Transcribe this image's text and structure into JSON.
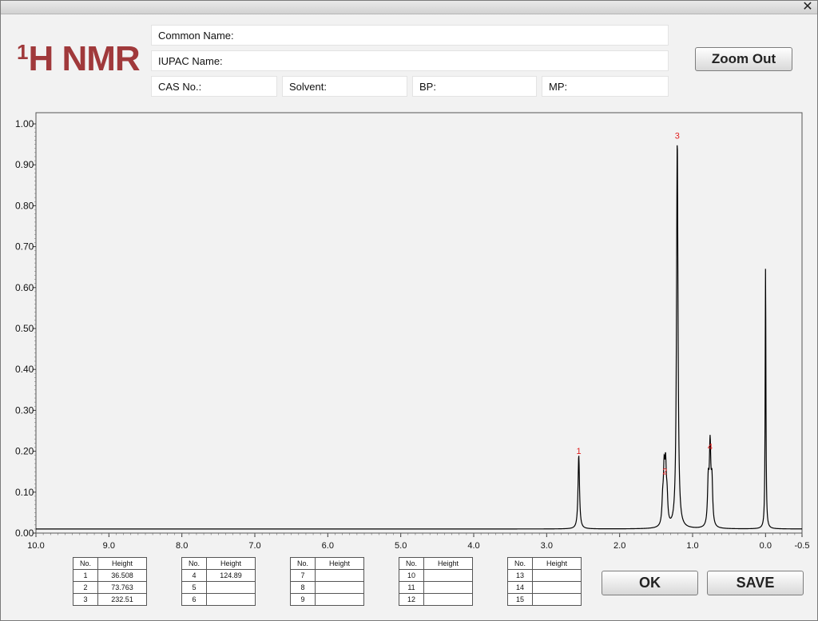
{
  "window": {
    "close_icon": "✕"
  },
  "title": {
    "superscript": "1",
    "text": "H NMR"
  },
  "fields": {
    "common_name": "Common Name:",
    "iupac_name": "IUPAC Name:",
    "cas_no": "CAS No.:",
    "solvent": "Solvent:",
    "bp": "BP:",
    "mp": "MP:"
  },
  "buttons": {
    "zoom_out": "Zoom Out",
    "ok": "OK",
    "save": "SAVE"
  },
  "colors": {
    "title": "#a0393b",
    "peak_label": "#e02020",
    "trace": "#000000"
  },
  "chart_data": {
    "type": "line",
    "x_ticks": [
      "10.0",
      "9.0",
      "8.0",
      "7.0",
      "6.0",
      "5.0",
      "4.0",
      "3.0",
      "2.0",
      "1.0",
      "0.0",
      "-0.5"
    ],
    "y_ticks": [
      "0.00",
      "0.10",
      "0.20",
      "0.30",
      "0.40",
      "0.50",
      "0.60",
      "0.70",
      "0.80",
      "0.90",
      "1.00"
    ],
    "xlim": [
      10.0,
      -0.5
    ],
    "ylim": [
      0,
      1.0
    ],
    "x_reversed": true,
    "grid": false,
    "baseline": 0.01,
    "peaks": [
      {
        "label": "1",
        "ppm": 2.56,
        "height": 0.18
      },
      {
        "label": "2",
        "ppm": 1.38,
        "height": 0.13
      },
      {
        "label": "3",
        "ppm": 1.21,
        "height": 0.95
      },
      {
        "label": "4",
        "ppm": 0.76,
        "height": 0.19
      },
      {
        "label": "",
        "ppm": 0.0,
        "height": 0.64
      }
    ]
  },
  "peak_tables": [
    {
      "headers": [
        "No.",
        "Height"
      ],
      "rows": [
        [
          "1",
          "36.508"
        ],
        [
          "2",
          "73.763"
        ],
        [
          "3",
          "232.51"
        ]
      ]
    },
    {
      "headers": [
        "No.",
        "Height"
      ],
      "rows": [
        [
          "4",
          "124.89"
        ],
        [
          "5",
          ""
        ],
        [
          "6",
          ""
        ]
      ]
    },
    {
      "headers": [
        "No.",
        "Height"
      ],
      "rows": [
        [
          "7",
          ""
        ],
        [
          "8",
          ""
        ],
        [
          "9",
          ""
        ]
      ]
    },
    {
      "headers": [
        "No.",
        "Height"
      ],
      "rows": [
        [
          "10",
          ""
        ],
        [
          "11",
          ""
        ],
        [
          "12",
          ""
        ]
      ]
    },
    {
      "headers": [
        "No.",
        "Height"
      ],
      "rows": [
        [
          "13",
          ""
        ],
        [
          "14",
          ""
        ],
        [
          "15",
          ""
        ]
      ]
    }
  ]
}
